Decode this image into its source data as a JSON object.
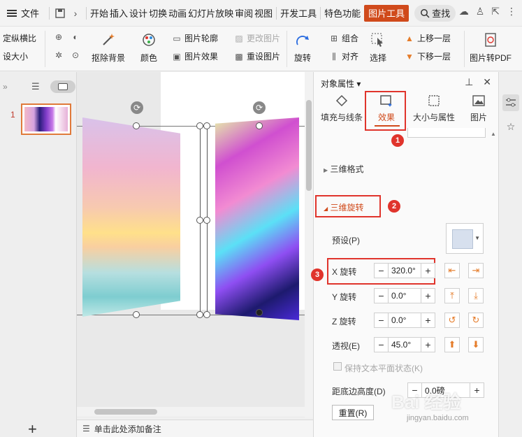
{
  "menubar": {
    "file_label": "文件",
    "tabs": [
      "开始",
      "插入",
      "设计",
      "切换",
      "动画",
      "幻灯片放映",
      "审阅",
      "视图",
      "开发工具",
      "特色功能"
    ],
    "active_tab": "图片工具",
    "search_label": "查找"
  },
  "ribbon": {
    "lock_ratio": "定纵横比",
    "reset_size": "设大小",
    "remove_bg": "抠除背景",
    "color": "颜色",
    "outline": "图片轮廓",
    "effect": "图片效果",
    "change_pic": "更改图片",
    "reset_pic": "重设图片",
    "rotate": "旋转",
    "group": "组合",
    "align": "对齐",
    "select": "选择",
    "bring_forward": "上移一层",
    "send_backward": "下移一层",
    "to_pdf": "图片转PDF"
  },
  "slides": {
    "number": "1"
  },
  "notes": {
    "placeholder": "单击此处添加备注"
  },
  "panel": {
    "title": "对象属性",
    "tabs": [
      "填充与线条",
      "效果",
      "大小与属性",
      "图片"
    ],
    "section_3d_format": "三维格式",
    "section_3d_rotation": "三维旋转",
    "preset_label": "预设(P)",
    "x_rotation_label": "X 旋转",
    "x_rotation_value": "320.0°",
    "y_rotation_label": "Y 旋转",
    "y_rotation_value": "0.0°",
    "z_rotation_label": "Z 旋转",
    "z_rotation_value": "0.0°",
    "perspective_label": "透视(E)",
    "perspective_value": "45.0°",
    "keep_flat_label": "保持文本平面状态(K)",
    "distance_label": "距底边高度(D)",
    "distance_value": "0.0磅",
    "reset_label": "重置(R)"
  },
  "annotations": [
    "1",
    "2",
    "3"
  ],
  "watermark": {
    "text": "Bai 经验",
    "sub": "jingyan.baidu.com"
  },
  "colors": {
    "accent": "#d04a1b",
    "highlight": "#e0342c"
  }
}
